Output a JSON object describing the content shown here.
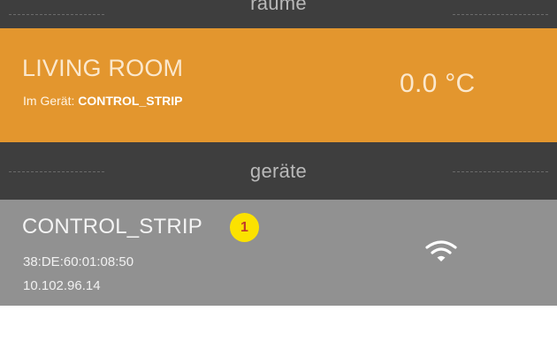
{
  "sections": {
    "rooms_header": "räume",
    "devices_header": "geräte"
  },
  "room": {
    "name": "LIVING ROOM",
    "device_prefix": "Im Gerät:",
    "device_name": "CONTROL_STRIP",
    "temperature": "0.0 °C",
    "color": "#e3962e"
  },
  "device": {
    "name": "CONTROL_STRIP",
    "badge": "1",
    "mac": "38:DE:60:01:08:50",
    "ip": "10.102.96.14",
    "status_icon": "wifi-icon",
    "color": "#919191"
  }
}
